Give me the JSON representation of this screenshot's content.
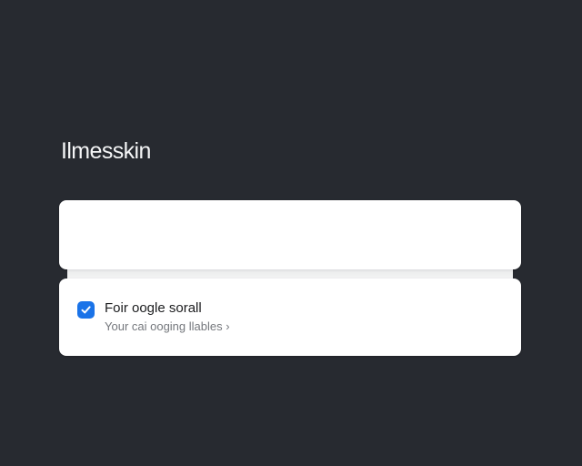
{
  "app": {
    "title": "Ilmesskin"
  },
  "setting_row": {
    "checked": true,
    "title": "Foir oogle sorall",
    "subtitle": "Your cai ooging llables ›",
    "icon": "checkbox-checked-icon"
  },
  "colors": {
    "background": "#272a30",
    "card": "#ffffff",
    "accent": "#1a73e8",
    "title_text": "#f4f5f6",
    "primary_text": "#1b1c1e",
    "secondary_text": "#75787d"
  }
}
